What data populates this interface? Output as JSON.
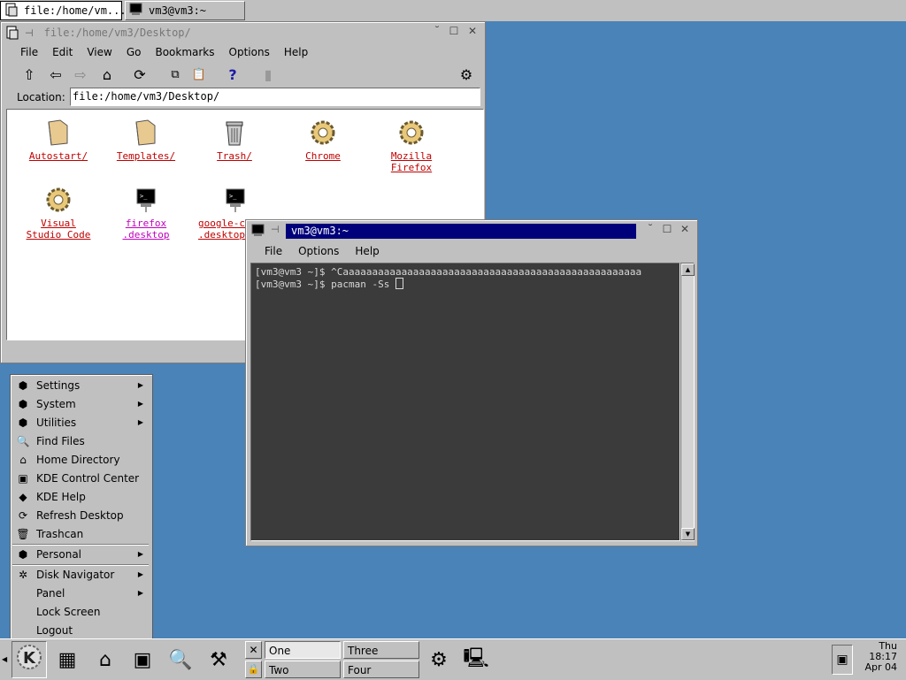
{
  "taskbar": {
    "tasks": [
      {
        "label": "file:/home/vm..."
      },
      {
        "label": "vm3@vm3:~"
      }
    ]
  },
  "konqueror": {
    "title": "file:/home/vm3/Desktop/",
    "menu": [
      "File",
      "Edit",
      "View",
      "Go",
      "Bookmarks",
      "Options",
      "Help"
    ],
    "location_label": "Location:",
    "location_value": "file:/home/vm3/Desktop/",
    "icons": [
      {
        "label": "Autostart/",
        "type": "folder-icon"
      },
      {
        "label": "Templates/",
        "type": "folder-icon"
      },
      {
        "label": "Trash/",
        "type": "trash-icon"
      },
      {
        "label": "Chrome",
        "type": "gear-icon"
      },
      {
        "label": "Mozilla\nFirefox",
        "type": "gear-icon"
      },
      {
        "label": "Visual\nStudio Code",
        "type": "gear-icon"
      },
      {
        "label": "firefox\n.desktop",
        "type": "terminal-icon"
      },
      {
        "label": "google-chrome\n.desktop",
        "type": "terminal-icon"
      }
    ]
  },
  "terminal": {
    "title": "vm3@vm3:~",
    "menu": [
      "File",
      "Options",
      "Help"
    ],
    "lines": [
      "[vm3@vm3 ~]$ ^Caaaaaaaaaaaaaaaaaaaaaaaaaaaaaaaaaaaaaaaaaaaaaaaaaaa",
      "[vm3@vm3 ~]$ pacman -Ss "
    ]
  },
  "kmenu": {
    "items": [
      {
        "label": "Settings",
        "submenu": true,
        "icon": "settings-icon"
      },
      {
        "label": "System",
        "submenu": true,
        "icon": "system-icon"
      },
      {
        "label": "Utilities",
        "submenu": true,
        "icon": "utilities-icon"
      },
      {
        "label": "Find Files",
        "submenu": false,
        "icon": "find-files-icon"
      },
      {
        "label": "Home Directory",
        "submenu": false,
        "icon": "home-icon"
      },
      {
        "label": "KDE Control Center",
        "submenu": false,
        "icon": "control-center-icon"
      },
      {
        "label": "KDE Help",
        "submenu": false,
        "icon": "help-icon"
      },
      {
        "label": "Refresh Desktop",
        "submenu": false,
        "icon": "refresh-icon"
      },
      {
        "label": "Trashcan",
        "submenu": false,
        "icon": "trash-icon"
      },
      {
        "label": "Personal",
        "submenu": true,
        "icon": "personal-icon"
      },
      {
        "label": "Disk Navigator",
        "submenu": true,
        "icon": "disk-navigator-icon"
      },
      {
        "label": "Panel",
        "submenu": true,
        "icon": ""
      },
      {
        "label": "Lock Screen",
        "submenu": false,
        "icon": ""
      },
      {
        "label": "Logout",
        "submenu": false,
        "icon": ""
      }
    ]
  },
  "panel": {
    "desktops": [
      "One",
      "Two",
      "Three",
      "Four"
    ],
    "active_desktop": "One",
    "clock": {
      "day": "Thu",
      "time": "18:17",
      "date": "Apr 04"
    }
  },
  "colors": {
    "desktop": "#4a83b7",
    "chrome": "#c0c0c0",
    "link": "#c00000",
    "link_visited": "#c000c0",
    "terminal_bg": "#3b3b3b",
    "active_title": "#00007a"
  }
}
